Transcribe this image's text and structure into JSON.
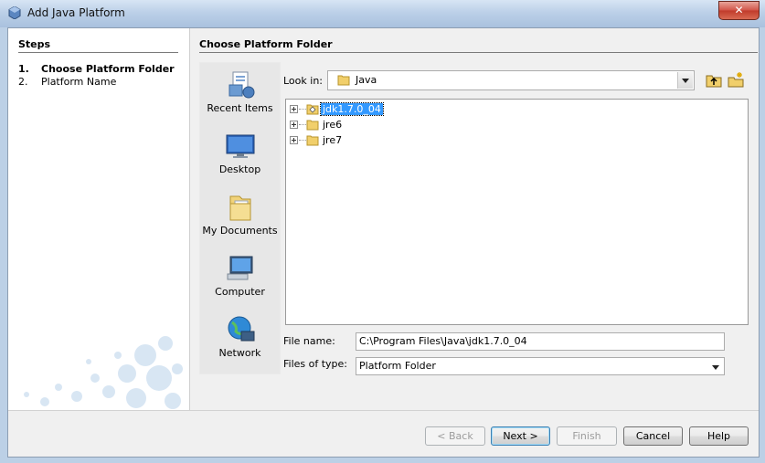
{
  "window": {
    "title": "Add Java Platform",
    "close_label": "✕"
  },
  "steps": {
    "title": "Steps",
    "items": [
      {
        "num": "1.",
        "label": "Choose Platform Folder"
      },
      {
        "num": "2.",
        "label": "Platform Name"
      }
    ]
  },
  "panel": {
    "title": "Choose Platform Folder"
  },
  "places": [
    {
      "label": "Recent Items",
      "icon": "recent-items-icon"
    },
    {
      "label": "Desktop",
      "icon": "desktop-icon"
    },
    {
      "label": "My Documents",
      "icon": "my-documents-icon"
    },
    {
      "label": "Computer",
      "icon": "computer-icon"
    },
    {
      "label": "Network",
      "icon": "network-icon"
    }
  ],
  "lookin": {
    "label": "Look in:",
    "value": "Java"
  },
  "files": [
    {
      "name": "jdk1.7.0_04",
      "selected": true
    },
    {
      "name": "jre6",
      "selected": false
    },
    {
      "name": "jre7",
      "selected": false
    }
  ],
  "file_name": {
    "label": "File name:",
    "value": "C:\\Program Files\\Java\\jdk1.7.0_04"
  },
  "file_type": {
    "label": "Files of type:",
    "value": "Platform Folder"
  },
  "buttons": {
    "back": "< Back",
    "next": "Next >",
    "finish": "Finish",
    "cancel": "Cancel",
    "help": "Help"
  }
}
